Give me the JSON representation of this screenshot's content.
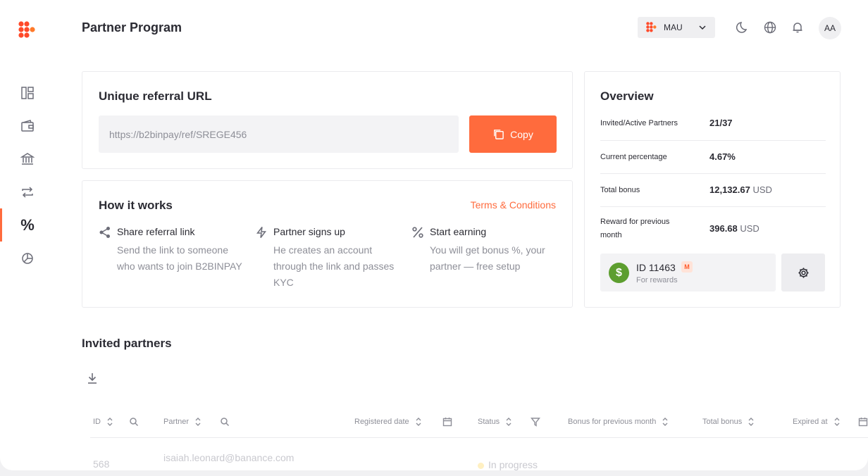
{
  "header": {
    "title": "Partner Program",
    "account_selector": "MAU",
    "avatar_initials": "AA"
  },
  "sidebar": {
    "items": [
      {
        "icon": "dashboard-icon"
      },
      {
        "icon": "wallet-icon"
      },
      {
        "icon": "bank-icon"
      },
      {
        "icon": "exchange-icon"
      },
      {
        "icon": "percent-icon",
        "label": "%",
        "active": true
      },
      {
        "icon": "pie-chart-icon"
      }
    ]
  },
  "referral": {
    "title": "Unique referral URL",
    "url": "https://b2binpay/ref/SREGE456",
    "copy_label": "Copy"
  },
  "how_it_works": {
    "title": "How it works",
    "terms_label": "Terms & Conditions",
    "steps": [
      {
        "icon": "share-icon",
        "title": "Share referral link",
        "desc": "Send the link to someone who wants to join B2BINPAY"
      },
      {
        "icon": "lightning-icon",
        "title": "Partner signs up",
        "desc": "He creates an account through the link and passes KYC"
      },
      {
        "icon": "percent-icon",
        "title": "Start earning",
        "desc": "You will get bonus %, your partner — free setup"
      }
    ]
  },
  "overview": {
    "title": "Overview",
    "rows": [
      {
        "label": "Invited/Active Partners",
        "value": "21/37",
        "currency": ""
      },
      {
        "label": "Current percentage",
        "value": "4.67%",
        "currency": ""
      },
      {
        "label": "Total bonus",
        "value": "12,132.67",
        "currency": " USD"
      },
      {
        "label": "Reward for previous month",
        "value": "396.68",
        "currency": " USD"
      }
    ],
    "reward": {
      "id_label": "ID 11463",
      "badge": "M",
      "sub_label": "For rewards",
      "coin_symbol": "$"
    }
  },
  "invited": {
    "title": "Invited partners",
    "columns": [
      "ID",
      "Partner",
      "Registered date",
      "Status",
      "Bonus for previous month",
      "Total bonus",
      "Expired at"
    ],
    "rows": [
      {
        "id": "568",
        "partner": "isaiah.leonard@banance.com",
        "status": "In progress"
      }
    ]
  },
  "colors": {
    "accent": "#ff6b3d",
    "coin_green": "#5d9e2f",
    "text": "#2b2b33",
    "muted": "#8e8f98"
  }
}
